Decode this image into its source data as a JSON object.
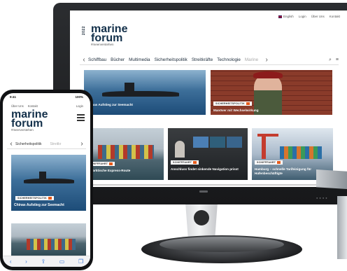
{
  "desktop": {
    "topbar": [
      "English",
      "Login",
      "Über Uns",
      "Kontakt"
    ],
    "logo_side": "2022",
    "logo_line1": "marine",
    "logo_line2": "forum",
    "tagline": "#meerverstehen",
    "nav": [
      "Schiffbau",
      "Bücher",
      "Multimedia",
      "Sicherheitspolitik",
      "Streitkräfte",
      "Technologie",
      "Marine"
    ],
    "tiles": [
      {
        "tag": "",
        "caption": "Chinas Aufstieg zur Seemacht"
      },
      {
        "tag": "SICHERHEITSPOLITIK",
        "caption": "Manöver mit Wechselwirkung"
      },
      {
        "tag": "SCHIFFFAHRT",
        "caption": "Die arktische Express-Route"
      },
      {
        "tag": "SCHIFFFAHRT",
        "caption": "Anschluss findet sinkende Navigation prisst"
      },
      {
        "tag": "SCHIFFFAHRT",
        "caption": "Hamburg – schnelle Tarifeinigung für Hafenbeschäftigte"
      }
    ],
    "colors": {
      "brand_navy": "#13304a",
      "accent_orange": "#e65a1a"
    }
  },
  "phone": {
    "status_time": "9:41",
    "status_right": "100%",
    "links": [
      "Über Uns",
      "Kontakt",
      "Login"
    ],
    "logo_line1": "marine",
    "logo_line2": "forum",
    "tagline": "#meerverstehen",
    "nav": [
      "Sicherheitspolitik",
      "Streitkr"
    ],
    "tile1": {
      "tag": "SICHERHEITSPOLITIK",
      "caption": "Chinas Aufstieg zur Seemacht"
    },
    "bottom_icons": [
      "back-icon",
      "forward-icon",
      "share-icon",
      "bookmarks-icon",
      "tabs-icon"
    ]
  }
}
